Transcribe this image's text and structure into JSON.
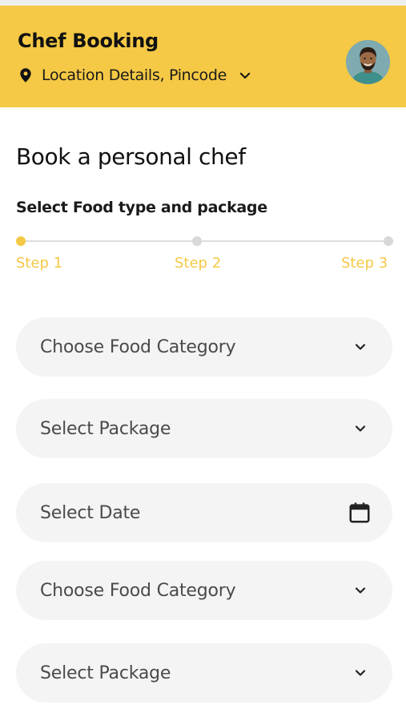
{
  "header": {
    "title": "Chef Booking",
    "location": "Location Details, Pincode",
    "location_icon": "map-pin-icon",
    "dropdown_icon": "chevron-down-icon",
    "avatar_icon": "user-avatar"
  },
  "colors": {
    "accent": "#f5c945",
    "field_bg": "#f4f4f4",
    "inactive_step": "#d8d8d8"
  },
  "main": {
    "title": "Book a personal chef",
    "subtitle": "Select Food type and package"
  },
  "stepper": {
    "current_step": 1,
    "steps": [
      {
        "label": "Step 1"
      },
      {
        "label": "Step 2"
      },
      {
        "label": "Step 3"
      }
    ]
  },
  "form": {
    "fields": [
      {
        "label": "Choose Food Category",
        "icon": "chevron-down-icon"
      },
      {
        "label": "Select Package",
        "icon": "chevron-down-icon"
      },
      {
        "label": "Select Date",
        "icon": "calendar-icon"
      },
      {
        "label": "Choose Food Category",
        "icon": "chevron-down-icon"
      },
      {
        "label": "Select Package",
        "icon": "chevron-down-icon"
      }
    ]
  }
}
